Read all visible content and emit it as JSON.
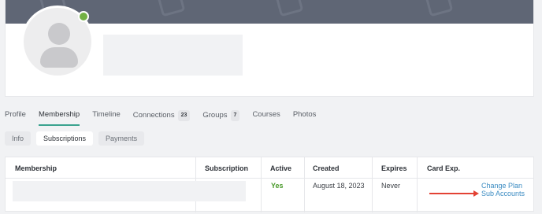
{
  "colors": {
    "accent": "#3aa38f",
    "link": "#3d8dc3",
    "active_green": "#4a9a2b",
    "arrow": "#e34234",
    "online": "#72b043"
  },
  "profile": {
    "avatar_icon": "person-placeholder-icon",
    "status_icon": "online-dot-icon",
    "cover_icon": "image-placeholder-icon"
  },
  "tabs": [
    {
      "label": "Profile"
    },
    {
      "label": "Membership"
    },
    {
      "label": "Timeline"
    },
    {
      "label": "Connections",
      "count": "23"
    },
    {
      "label": "Groups",
      "count": "7"
    },
    {
      "label": "Courses"
    },
    {
      "label": "Photos"
    }
  ],
  "subtabs": [
    {
      "label": "Info"
    },
    {
      "label": "Subscriptions"
    },
    {
      "label": "Payments"
    }
  ],
  "table": {
    "headers": {
      "membership": "Membership",
      "subscription": "Subscription",
      "active": "Active",
      "created": "Created",
      "expires": "Expires",
      "card_exp": "Card Exp."
    },
    "row": {
      "active": "Yes",
      "created": "August 18, 2023",
      "expires": "Never",
      "change_plan": "Change Plan",
      "sub_accounts": "Sub Accounts"
    }
  }
}
